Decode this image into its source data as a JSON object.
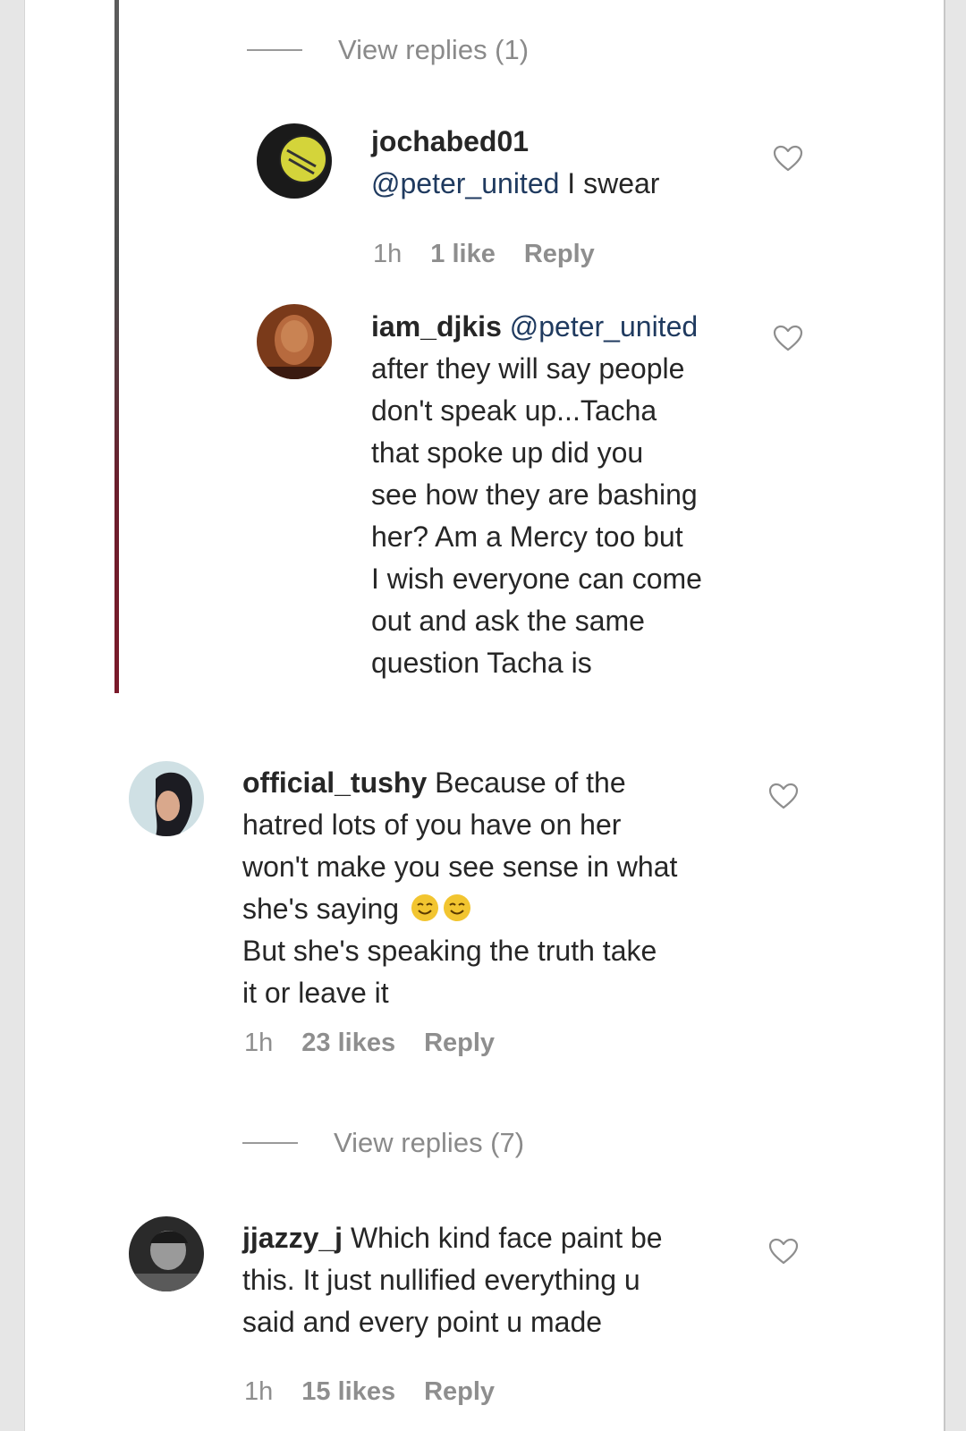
{
  "top_view_replies": "View replies (1)",
  "comments": [
    {
      "username": "jochabed01",
      "mention": "@peter_united",
      "text": " I swear",
      "time": "1h",
      "likes": "1 like",
      "reply": "Reply"
    },
    {
      "username": "iam_djkis",
      "mention": "@peter_united",
      "lines": [
        "after they will say people",
        "don't speak up...Tacha",
        "that spoke up did you",
        "see how they are bashing",
        "her? Am a Mercy too but",
        "I wish everyone can come",
        "out and ask the same",
        "question Tacha is"
      ]
    },
    {
      "username": "official_tushy",
      "first_line": " Because of the",
      "lines": [
        "hatred lots of you have on her",
        "won't make you see sense in what",
        "she's saying",
        "But she's speaking the truth take",
        "it or leave it"
      ],
      "time": "1h",
      "likes": "23 likes",
      "reply": "Reply",
      "view_replies": "View replies (7)"
    },
    {
      "username": "jjazzy_j",
      "first_line": " Which kind face paint be",
      "lines": [
        "this. It just nullified everything u",
        "said and every point u made"
      ],
      "time": "1h",
      "likes": "15 likes",
      "reply": "Reply"
    }
  ],
  "colors": {
    "page_bg": "#e6e6e6",
    "card_bg": "#ffffff",
    "text": "#262626",
    "muted": "#8e8e8e",
    "mention": "#1f3a5f"
  }
}
